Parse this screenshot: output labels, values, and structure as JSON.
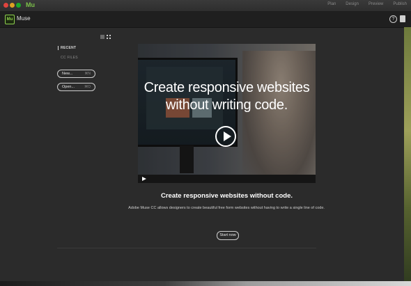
{
  "window": {
    "app_title": "Mu"
  },
  "topnav": {
    "items": [
      "Plan",
      "Design",
      "Preview",
      "Publish"
    ]
  },
  "header": {
    "logo_text": "Mu",
    "app_name": "Muse",
    "help_glyph": "?"
  },
  "sidebar": {
    "recent_label": "RECENT",
    "cc_files_label": "CC FILES",
    "new_button": {
      "label": "New...",
      "shortcut": "⌘N"
    },
    "open_button": {
      "label": "Open...",
      "shortcut": "⌘O"
    }
  },
  "hero": {
    "line1": "Create responsive websites",
    "line2": "without writing code."
  },
  "content": {
    "headline": "Create responsive websites without code.",
    "description": "Adobe Muse CC allows designers to create beautiful free form websites without having to write a single line of code.",
    "start_button": "Start now"
  },
  "colors": {
    "accent": "#8fd14f",
    "background": "#2b2b2b",
    "appbar": "#1f1f1f"
  },
  "icons": [
    "help-icon",
    "user-icon",
    "list-view-icon",
    "grid-view-icon",
    "play-icon"
  ]
}
